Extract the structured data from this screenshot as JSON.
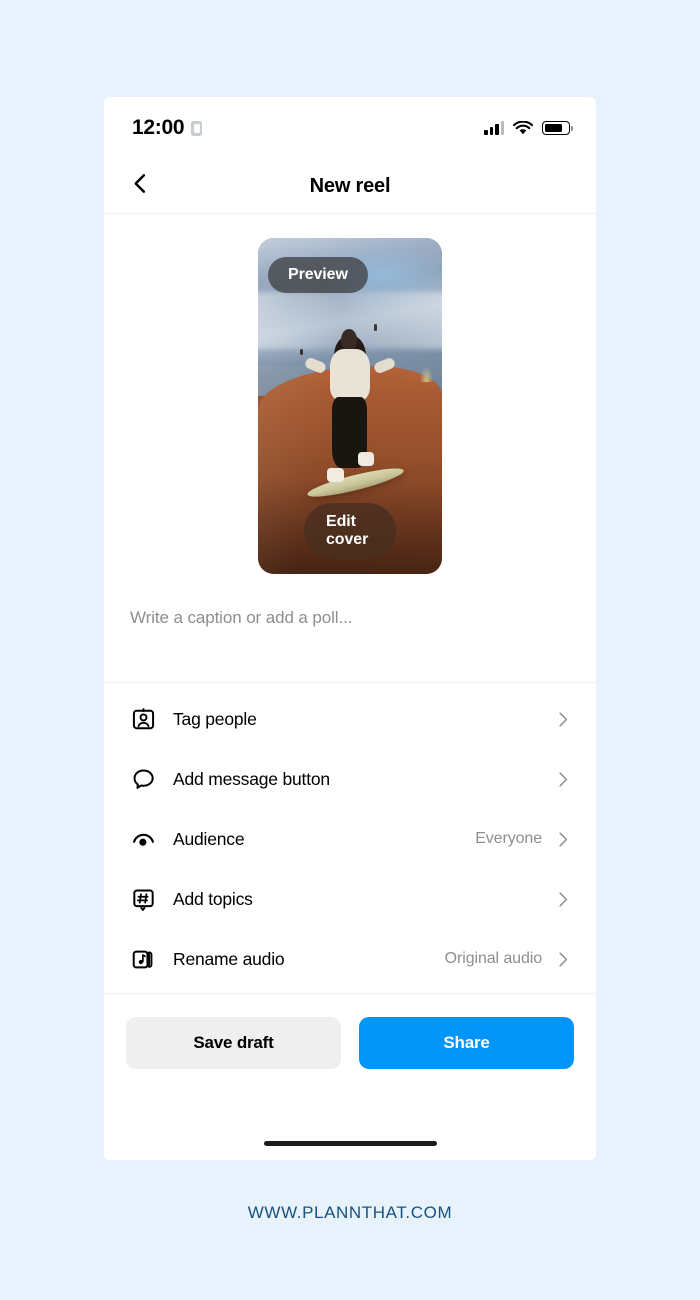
{
  "page": {
    "background_color": "#e7f2fc"
  },
  "status_bar": {
    "time": "12:00",
    "recording_icon": "screen-record-badge-icon",
    "signal_icon": "cellular-signal-icon",
    "wifi_icon": "wifi-icon",
    "battery_icon": "battery-icon"
  },
  "navbar": {
    "back_icon": "chevron-left-icon",
    "title": "New reel"
  },
  "preview": {
    "preview_pill_label": "Preview",
    "edit_cover_label": "Edit cover",
    "image_description": "sandboarder riding down a desert dune"
  },
  "caption": {
    "value": "",
    "placeholder": "Write a caption or add a poll..."
  },
  "options": [
    {
      "icon": "tag-people-icon",
      "label": "Tag people",
      "value": "",
      "chevron": "chevron-right-icon"
    },
    {
      "icon": "message-bubble-icon",
      "label": "Add message button",
      "value": "",
      "chevron": "chevron-right-icon"
    },
    {
      "icon": "audience-eye-icon",
      "label": "Audience",
      "value": "Everyone",
      "chevron": "chevron-right-icon"
    },
    {
      "icon": "hashtag-topics-icon",
      "label": "Add topics",
      "value": "",
      "chevron": "chevron-right-icon"
    },
    {
      "icon": "music-note-icon",
      "label": "Rename audio",
      "value": "Original audio",
      "chevron": "chevron-right-icon"
    }
  ],
  "actions": {
    "save_draft_label": "Save draft",
    "share_label": "Share",
    "share_color": "#0095f6",
    "draft_color": "#efefef"
  },
  "footer": {
    "text": "WWW.PLANNTHAT.COM",
    "color": "#17527e"
  }
}
